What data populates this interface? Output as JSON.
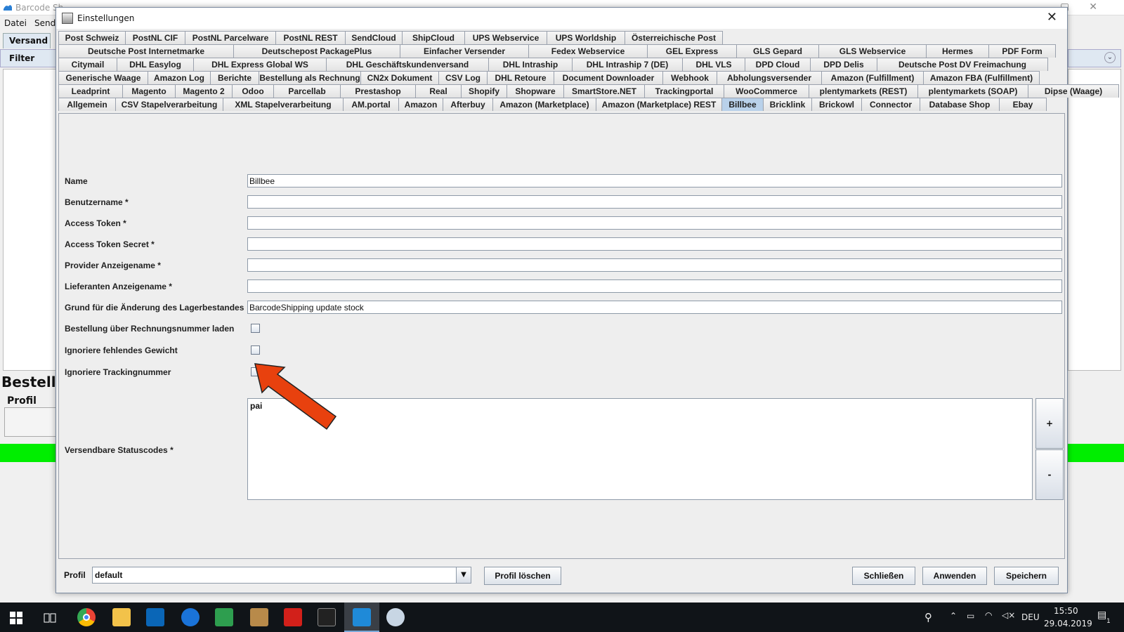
{
  "background_app": {
    "title": "Barcode Sh",
    "menu": [
      "Datei",
      "Send"
    ],
    "tab": "Versand",
    "filter_label": "Filter",
    "section_title": "Bestellu",
    "profil_label": "Profil"
  },
  "dialog": {
    "title": "Einstellungen",
    "close_glyph": "✕",
    "tab_rows": [
      [
        "Post Schweiz",
        "PostNL CIF",
        "PostNL Parcelware",
        "PostNL REST",
        "SendCloud",
        "ShipCloud",
        "UPS Webservice",
        "UPS Worldship",
        "Österreichische Post"
      ],
      [
        "Deutsche Post Internetmarke",
        "Deutschepost PackagePlus",
        "Einfacher Versender",
        "Fedex Webservice",
        "GEL Express",
        "GLS Gepard",
        "GLS Webservice",
        "Hermes",
        "PDF Form"
      ],
      [
        "Citymail",
        "DHL Easylog",
        "DHL Express Global WS",
        "DHL Geschäftskundenversand",
        "DHL Intraship",
        "DHL Intraship 7 (DE)",
        "DHL VLS",
        "DPD Cloud",
        "DPD Delis",
        "Deutsche Post DV Freimachung"
      ],
      [
        "Generische Waage",
        "Amazon Log",
        "Berichte",
        "Bestellung als Rechnung",
        "CN2x Dokument",
        "CSV Log",
        "DHL Retoure",
        "Document Downloader",
        "Webhook",
        "Abholungsversender",
        "Amazon (Fulfillment)",
        "Amazon FBA (Fulfillment)"
      ],
      [
        "Leadprint",
        "Magento",
        "Magento 2",
        "Odoo",
        "Parcellab",
        "Prestashop",
        "Real",
        "Shopify",
        "Shopware",
        "SmartStore.NET",
        "Trackingportal",
        "WooCommerce",
        "plentymarkets (REST)",
        "plentymarkets (SOAP)",
        "Dipse (Waage)"
      ],
      [
        "Allgemein",
        "CSV Stapelverarbeitung",
        "XML Stapelverarbeitung",
        "AM.portal",
        "Amazon",
        "Afterbuy",
        "Amazon (Marketplace)",
        "Amazon (Marketplace) REST",
        "Billbee",
        "Bricklink",
        "Brickowl",
        "Connector",
        "Database Shop",
        "Ebay"
      ]
    ],
    "selected_tab": "Billbee",
    "fields": {
      "name_label": "Name",
      "name_value": "Billbee",
      "benutzername_label": "Benutzername *",
      "benutzername_value": "",
      "access_token_label": "Access Token *",
      "access_token_value": "",
      "access_token_secret_label": "Access Token Secret *",
      "access_token_secret_value": "",
      "provider_label": "Provider Anzeigename *",
      "provider_value": "",
      "lieferanten_label": "Lieferanten Anzeigename *",
      "lieferanten_value": "",
      "grund_label": "Grund für die Änderung des Lagerbestandes",
      "grund_value": "BarcodeShipping update stock",
      "rechnungsnummer_label": "Bestellung über Rechnungsnummer laden",
      "rechnungsnummer_checked": false,
      "gewicht_label": "Ignoriere fehlendes Gewicht",
      "gewicht_checked": false,
      "tracking_label": "Ignoriere Trackingnummer",
      "tracking_checked": false,
      "statuscodes_label": "Versendbare Statuscodes *",
      "statuscodes_value": "pai",
      "add_label": "+",
      "remove_label": "-"
    },
    "footer": {
      "profil_label": "Profil",
      "profil_value": "default",
      "profil_delete": "Profil löschen",
      "close": "Schließen",
      "apply": "Anwenden",
      "save": "Speichern"
    }
  },
  "annotation": {
    "color": "#e8410e"
  },
  "taskbar": {
    "language": "DEU",
    "time": "15:50",
    "date": "29.04.2019",
    "notifications": "1",
    "icons": [
      "windows-start",
      "task-view",
      "chrome",
      "file-explorer",
      "vscode",
      "teamviewer",
      "spreadsheet-app",
      "package-app",
      "acrobat",
      "terminal",
      "barcode-shipping",
      "paint-app"
    ]
  }
}
